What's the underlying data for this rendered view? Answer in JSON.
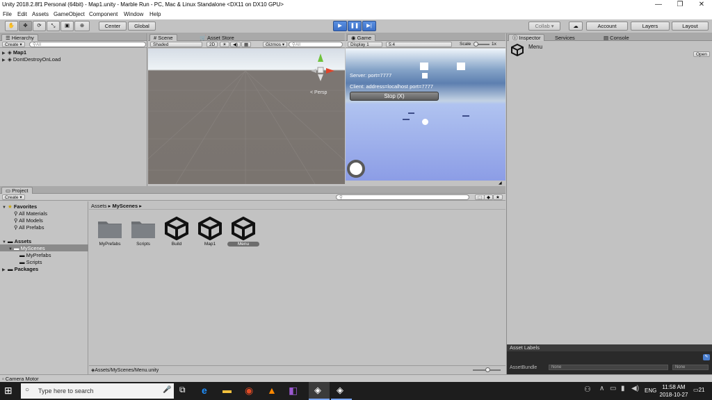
{
  "window": {
    "title": "Unity 2018.2.8f1 Personal (64bit) - Map1.unity - Marble Run - PC, Mac & Linux Standalone <DX11 on DX10 GPU>",
    "controls": [
      "—",
      "❐",
      "✕"
    ]
  },
  "menu": [
    "File",
    "Edit",
    "Assets",
    "GameObject",
    "Component",
    "Window",
    "Help"
  ],
  "toolbar": {
    "pivot": "Center",
    "space": "Global",
    "collab": "Collab ▾",
    "account": "Account",
    "layers": "Layers",
    "layout": "Layout",
    "play_state": "playing"
  },
  "hierarchy": {
    "tab": "Hierarchy",
    "create": "Create ▾",
    "search_placeholder": "All",
    "items": [
      "Map1",
      "DontDestroyOnLoad"
    ]
  },
  "scene": {
    "tab": "Scene",
    "tab2": "Asset Store",
    "shading": "Shaded",
    "mode2d": "2D",
    "gizmos": "Gizmos ▾",
    "search_placeholder": "All",
    "persp": "Persp"
  },
  "game": {
    "tab": "Game",
    "display": "Display 1",
    "aspect": "5:4",
    "scale_label": "Scale",
    "scale_value": "1x",
    "server_text": "Server: port=7777",
    "client_text": "Client: address=localhost port=7777",
    "stop_button": "Stop (X)"
  },
  "inspector": {
    "tab": "Inspector",
    "tab2": "Services",
    "tab3": "Console",
    "object_name": "Menu",
    "open_button": "Open",
    "asset_labels": "Asset Labels",
    "asset_bundle_label": "AssetBundle",
    "bundle_value": "None",
    "variant_value": "None"
  },
  "project": {
    "tab": "Project",
    "create": "Create ▾",
    "favorites_label": "Favorites",
    "favorites": [
      "All Materials",
      "All Models",
      "All Prefabs"
    ],
    "assets_label": "Assets",
    "tree": [
      "MyScenes",
      "MyPrefabs",
      "Scripts"
    ],
    "packages_label": "Packages",
    "breadcrumb_root": "Assets",
    "breadcrumb_current": "MyScenes",
    "items": [
      {
        "name": "MyPrefabs",
        "kind": "folder"
      },
      {
        "name": "Scripts",
        "kind": "folder"
      },
      {
        "name": "Build",
        "kind": "scene"
      },
      {
        "name": "Map1",
        "kind": "scene"
      },
      {
        "name": "Menu",
        "kind": "scene",
        "selected": true
      }
    ],
    "footer_path": "Assets/MyScenes/Menu.unity"
  },
  "status": {
    "message": "Camera Motor"
  },
  "taskbar": {
    "search_placeholder": "Type here to search",
    "lang": "ENG",
    "time": "11:58 AM",
    "date": "2018-10-27",
    "notifications": "21"
  },
  "colors": {
    "play_blue": "#3c70c8",
    "taskbar": "#1d1d1d"
  }
}
